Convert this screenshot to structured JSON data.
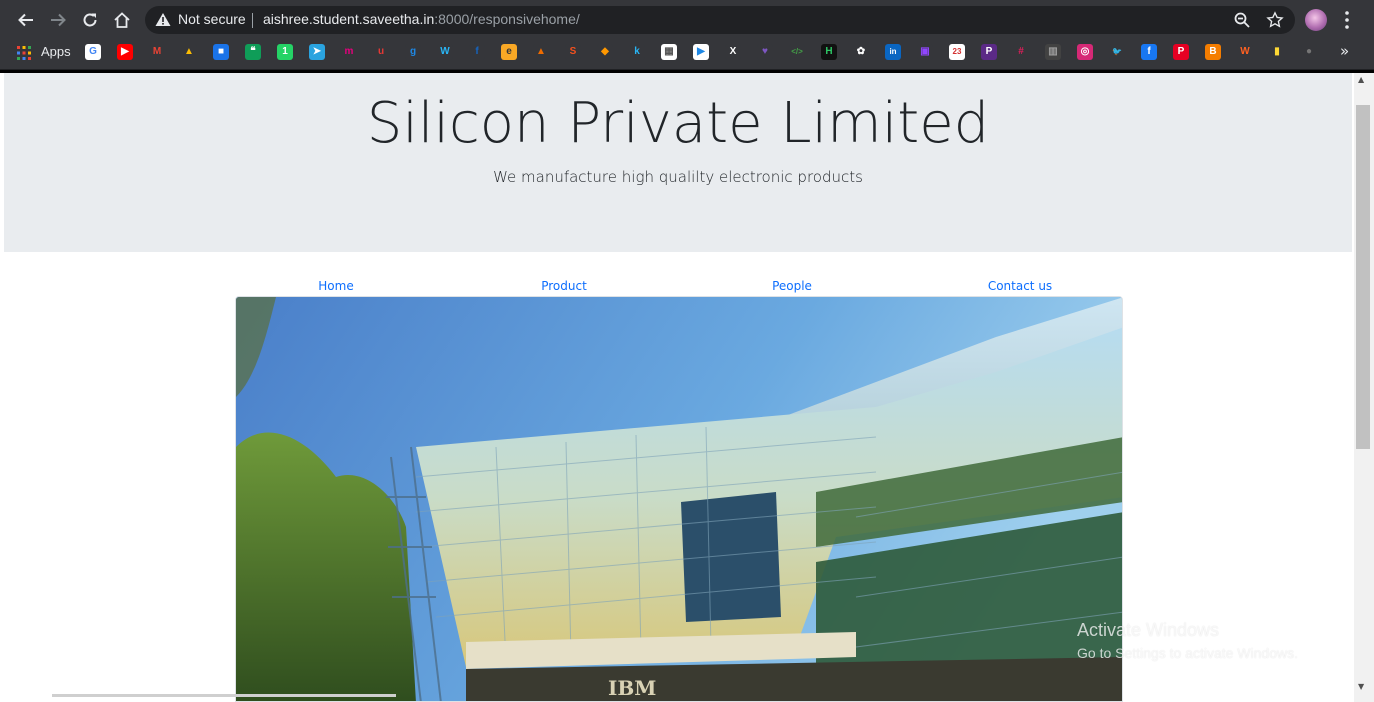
{
  "browser": {
    "security_label": "Not secure",
    "url_host": "aishree.student.saveetha.in",
    "url_rest": ":8000/responsivehome/",
    "apps_label": "Apps",
    "bookmarks": [
      {
        "name": "google-bookmark-icon",
        "glyph": "G",
        "bg": "#ffffff",
        "fg": "#4285f4"
      },
      {
        "name": "youtube-bookmark-icon",
        "glyph": "▶",
        "bg": "#ff0000",
        "fg": "#ffffff"
      },
      {
        "name": "gmail-bookmark-icon",
        "glyph": "M",
        "bg": "#35363a",
        "fg": "#ea4335"
      },
      {
        "name": "drive-bookmark-icon",
        "glyph": "▲",
        "bg": "#35363a",
        "fg": "#fbbc04"
      },
      {
        "name": "meet-bookmark-icon",
        "glyph": "■",
        "bg": "#1a73e8",
        "fg": "#ffffff"
      },
      {
        "name": "hangouts-bookmark-icon",
        "glyph": "❝",
        "bg": "#0f9d58",
        "fg": "#ffffff"
      },
      {
        "name": "whatsapp-bookmark-icon",
        "glyph": "1",
        "bg": "#25d366",
        "fg": "#ffffff"
      },
      {
        "name": "telegram-bookmark-icon",
        "glyph": "➤",
        "bg": "#2aa3df",
        "fg": "#ffffff"
      },
      {
        "name": "m-bookmark-icon",
        "glyph": "m",
        "bg": "#35363a",
        "fg": "#e5007d"
      },
      {
        "name": "u-bookmark-icon",
        "glyph": "u",
        "bg": "#35363a",
        "fg": "#e53935"
      },
      {
        "name": "g-bookmark-icon",
        "glyph": "g",
        "bg": "#35363a",
        "fg": "#1e88e5"
      },
      {
        "name": "w-bookmark-icon",
        "glyph": "W",
        "bg": "#35363a",
        "fg": "#29b6f6"
      },
      {
        "name": "f-bookmark-icon",
        "glyph": "f",
        "bg": "#35363a",
        "fg": "#1565c0"
      },
      {
        "name": "eduroam-bookmark-icon",
        "glyph": "e",
        "bg": "#f9a825",
        "fg": "#35363a"
      },
      {
        "name": "triangle-bookmark-icon",
        "glyph": "▲",
        "bg": "#35363a",
        "fg": "#ef6c00"
      },
      {
        "name": "s-bookmark-icon",
        "glyph": "S",
        "bg": "#35363a",
        "fg": "#f4511e"
      },
      {
        "name": "cube-bookmark-icon",
        "glyph": "◆",
        "bg": "#35363a",
        "fg": "#ff9800"
      },
      {
        "name": "k-bookmark-icon",
        "glyph": "k",
        "bg": "#35363a",
        "fg": "#29b6f6"
      },
      {
        "name": "sim-bookmark-icon",
        "glyph": "▦",
        "bg": "#ffffff",
        "fg": "#555555"
      },
      {
        "name": "play-bookmark-icon",
        "glyph": "▶",
        "bg": "#ffffff",
        "fg": "#1e88e5"
      },
      {
        "name": "x-bookmark-icon",
        "glyph": "X",
        "bg": "#35363a",
        "fg": "#ffffff"
      },
      {
        "name": "heart-bookmark-icon",
        "glyph": "♥",
        "bg": "#35363a",
        "fg": "#7e57c2"
      },
      {
        "name": "code-bookmark-icon",
        "glyph": "</>",
        "bg": "#35363a",
        "fg": "#43a047"
      },
      {
        "name": "hackerrank-bookmark-icon",
        "glyph": "H",
        "bg": "#111111",
        "fg": "#2ec866"
      },
      {
        "name": "clover-bookmark-icon",
        "glyph": "✿",
        "bg": "#35363a",
        "fg": "#ffffff"
      },
      {
        "name": "linkedin-bookmark-icon",
        "glyph": "in",
        "bg": "#0a66c2",
        "fg": "#ffffff"
      },
      {
        "name": "twitch-bookmark-icon",
        "glyph": "▣",
        "bg": "#35363a",
        "fg": "#9146ff"
      },
      {
        "name": "calendar-bookmark-icon",
        "glyph": "23",
        "bg": "#ffffff",
        "fg": "#d32f2f"
      },
      {
        "name": "p-bookmark-icon",
        "glyph": "P",
        "bg": "#5b2a86",
        "fg": "#ffffff"
      },
      {
        "name": "slack-bookmark-icon",
        "glyph": "#",
        "bg": "#35363a",
        "fg": "#e01e5a"
      },
      {
        "name": "grey-bookmark-icon",
        "glyph": "▥",
        "bg": "#424242",
        "fg": "#9e9e9e"
      },
      {
        "name": "instagram-bookmark-icon",
        "glyph": "◎",
        "bg": "#d62976",
        "fg": "#ffffff"
      },
      {
        "name": "twitter-bookmark-icon",
        "glyph": "🐦",
        "bg": "#35363a",
        "fg": "#1da1f2"
      },
      {
        "name": "facebook-bookmark-icon",
        "glyph": "f",
        "bg": "#1877f2",
        "fg": "#ffffff"
      },
      {
        "name": "pinterest-bookmark-icon",
        "glyph": "P",
        "bg": "#e60023",
        "fg": "#ffffff"
      },
      {
        "name": "blogger-bookmark-icon",
        "glyph": "B",
        "bg": "#f57d00",
        "fg": "#ffffff"
      },
      {
        "name": "wattpad-bookmark-icon",
        "glyph": "W",
        "bg": "#35363a",
        "fg": "#ff6122"
      },
      {
        "name": "bottle-bookmark-icon",
        "glyph": "▮",
        "bg": "#35363a",
        "fg": "#fdd835"
      },
      {
        "name": "github-bookmark-icon",
        "glyph": "●",
        "bg": "#35363a",
        "fg": "#757575"
      }
    ]
  },
  "page": {
    "title": "Silicon Private Limited",
    "subtitle": "We manufacture high qualilty electronic products",
    "nav": [
      {
        "label": "Home"
      },
      {
        "label": "Product"
      },
      {
        "label": "People"
      },
      {
        "label": "Contact us"
      }
    ],
    "image_caption_sign": "IBM",
    "link_color": "#0d6efd",
    "jumbotron_color": "#e9ecef"
  },
  "os_overlay": {
    "line1": "Activate Windows",
    "line2": "Go to Settings to activate Windows."
  }
}
